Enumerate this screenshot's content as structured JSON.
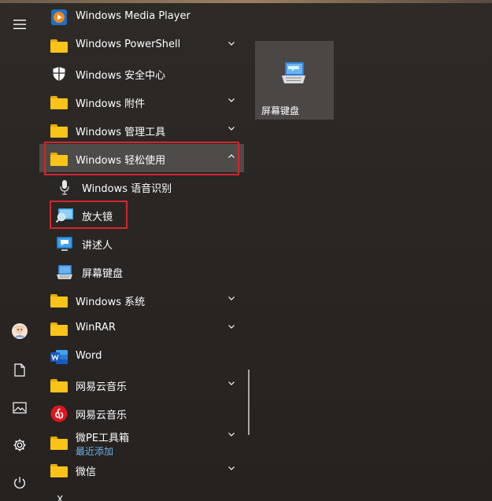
{
  "apps": {
    "media_player": "Windows Media Player",
    "powershell": "Windows PowerShell",
    "security": "Windows 安全中心",
    "accessories": "Windows 附件",
    "admin_tools": "Windows 管理工具",
    "ease_of_access": "Windows 轻松使用",
    "speech": "Windows 语音识别",
    "magnifier": "放大镜",
    "narrator": "讲述人",
    "osk": "屏幕键盘",
    "system": "Windows 系统",
    "winrar": "WinRAR",
    "word": "Word",
    "netease_folder": "网易云音乐",
    "netease_app": "网易云音乐",
    "wepe": "微PE工具箱",
    "wepe_sub": "最近添加",
    "wechat": "微信",
    "next_section": "X"
  },
  "tile": {
    "label": "屏幕键盘"
  },
  "colors": {
    "highlight": "#d4262e",
    "folder": "#f9c31a",
    "accent": "#6ab4f0"
  }
}
